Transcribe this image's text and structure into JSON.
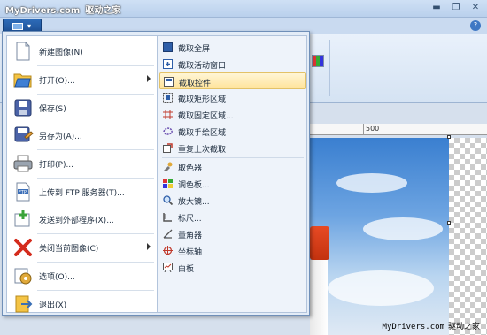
{
  "watermark_top": {
    "site": "MyDrivers.com",
    "cn": "驱动之家"
  },
  "window_controls": {
    "minimize": "▬",
    "restore": "❐",
    "close": "✕"
  },
  "ribbon": {
    "app_button_arrow": "▾",
    "help": "?"
  },
  "ruler": {
    "mark_500": "500"
  },
  "app_menu": {
    "left_items": [
      {
        "label": "新建图像(N)",
        "icon": "new-file-icon"
      },
      {
        "label": "打开(O)...",
        "icon": "open-folder-icon",
        "submenu": true
      },
      {
        "label": "保存(S)",
        "icon": "save-icon"
      },
      {
        "label": "另存为(A)...",
        "icon": "save-as-icon"
      },
      {
        "label": "打印(P)...",
        "icon": "printer-icon"
      },
      {
        "label": "上传到 FTP 服务器(T)...",
        "icon": "ftp-icon"
      },
      {
        "label": "发送到外部程序(X)...",
        "icon": "send-external-icon"
      },
      {
        "label": "关闭当前图像(C)",
        "icon": "close-image-icon",
        "submenu": true
      },
      {
        "label": "选项(O)...",
        "icon": "options-gear-icon"
      },
      {
        "label": "退出(X)",
        "icon": "exit-icon"
      }
    ],
    "right_items": [
      {
        "label": "截取全屏",
        "icon": "fullscreen-capture-icon"
      },
      {
        "label": "截取活动窗口",
        "icon": "window-capture-icon"
      },
      {
        "label": "截取控件",
        "icon": "control-capture-icon",
        "highlighted": true
      },
      {
        "label": "截取矩形区域",
        "icon": "rect-capture-icon"
      },
      {
        "label": "截取固定区域...",
        "icon": "fixed-region-icon"
      },
      {
        "label": "截取手绘区域",
        "icon": "freehand-capture-icon"
      },
      {
        "label": "重复上次截取",
        "icon": "repeat-capture-icon"
      },
      {
        "label": "取色器",
        "icon": "color-picker-icon"
      },
      {
        "label": "调色板...",
        "icon": "palette-icon"
      },
      {
        "label": "放大镜...",
        "icon": "magnifier-icon"
      },
      {
        "label": "标尺...",
        "icon": "ruler-icon"
      },
      {
        "label": "量角器",
        "icon": "protractor-icon"
      },
      {
        "label": "坐标轴",
        "icon": "crosshair-icon"
      },
      {
        "label": "白板",
        "icon": "whiteboard-icon"
      }
    ]
  },
  "watermark_bottom": {
    "site": "MyDrivers.com",
    "cn": "驱动之家"
  }
}
